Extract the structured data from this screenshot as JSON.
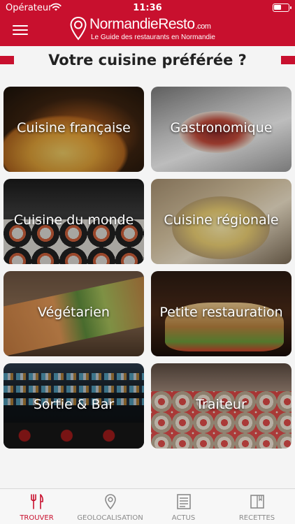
{
  "status_bar": {
    "carrier": "Opérateur",
    "time": "11:36"
  },
  "header": {
    "brand_main": "NormandieResto",
    "brand_tld": ".com",
    "tagline": "Le Guide des restaurants en Normandie"
  },
  "page": {
    "title": "Votre cuisine préférée ?"
  },
  "categories": [
    {
      "label": "Cuisine française"
    },
    {
      "label": "Gastronomique"
    },
    {
      "label": "Cuisine du monde"
    },
    {
      "label": "Cuisine régionale"
    },
    {
      "label": "Végétarien"
    },
    {
      "label": "Petite restauration"
    },
    {
      "label": "Sortie & Bar"
    },
    {
      "label": "Traiteur"
    }
  ],
  "tabs": [
    {
      "label": "TROUVER",
      "icon": "fork-knife-icon",
      "active": true
    },
    {
      "label": "GEOLOCALISATION",
      "icon": "location-pin-icon",
      "active": false
    },
    {
      "label": "ACTUS",
      "icon": "newspaper-icon",
      "active": false
    },
    {
      "label": "RECETTES",
      "icon": "recipe-book-icon",
      "active": false
    }
  ],
  "colors": {
    "brand_red": "#c8102e",
    "tab_inactive": "#8a8a8a",
    "background": "#f4f4f4"
  }
}
